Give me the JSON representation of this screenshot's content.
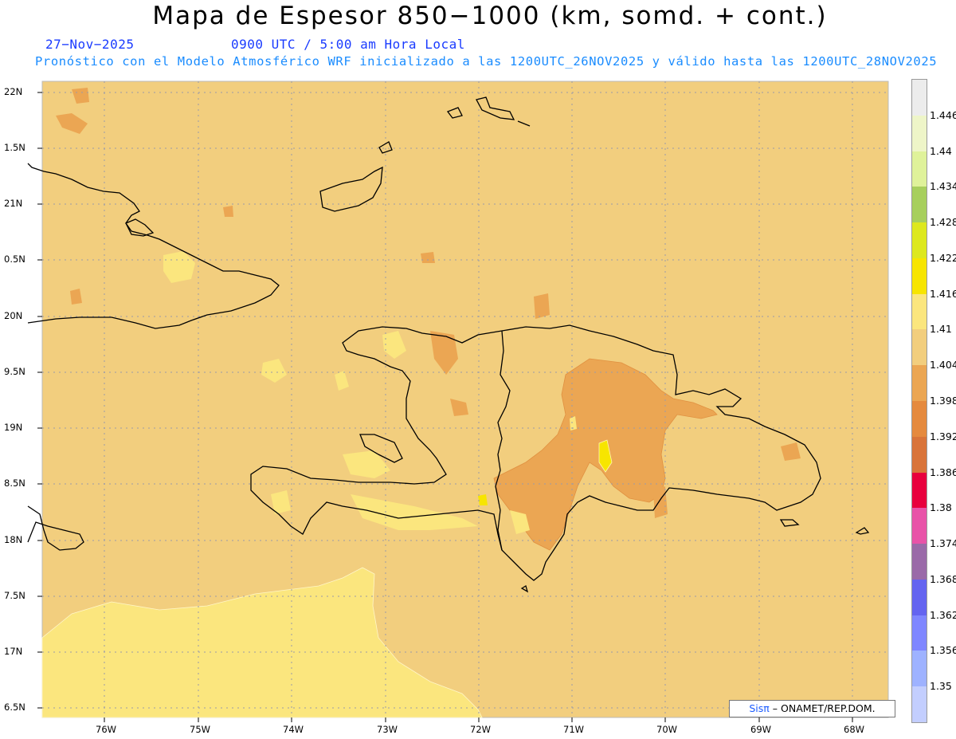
{
  "header": {
    "title": "Mapa de Espesor 850−1000 (km, somd. + cont.)",
    "date": "27−Nov−2025",
    "time": "0900 UTC / 5:00 am Hora Local",
    "description": "Pronóstico con el Modelo Atmosférico WRF inicializado a las 1200UTC_26NOV2025 y válido hasta las  1200UTC_28NOV2025"
  },
  "map": {
    "lat_labels": [
      "22N",
      "1.5N",
      "21N",
      "0.5N",
      "20N",
      "9.5N",
      "19N",
      "8.5N",
      "18N",
      "7.5N",
      "17N",
      "6.5N"
    ],
    "lon_labels": [
      "76W",
      "75W",
      "74W",
      "73W",
      "72W",
      "71W",
      "70W",
      "69W",
      "68W"
    ],
    "background_color": "#f2ce7e"
  },
  "colorbar": {
    "labels": [
      "1.446",
      "1.44",
      "1.434",
      "1.428",
      "1.422",
      "1.416",
      "1.41",
      "1.404",
      "1.398",
      "1.392",
      "1.386",
      "1.38",
      "1.374",
      "1.368",
      "1.362",
      "1.356",
      "1.35"
    ],
    "colors": [
      "#ececec",
      "#eef5c8",
      "#dff29a",
      "#a7cf5d",
      "#dde81e",
      "#f7e500",
      "#fbe67e",
      "#f2ce7e",
      "#eba653",
      "#e58a3e",
      "#d9743a",
      "#e8003d",
      "#e853a8",
      "#9a6aa8",
      "#6464f0",
      "#7f86ff",
      "#9eb2ff",
      "#c3cefe"
    ]
  },
  "credit": {
    "sis": "Sisπ",
    "rest": "– ONAMET/REP.DOM."
  }
}
